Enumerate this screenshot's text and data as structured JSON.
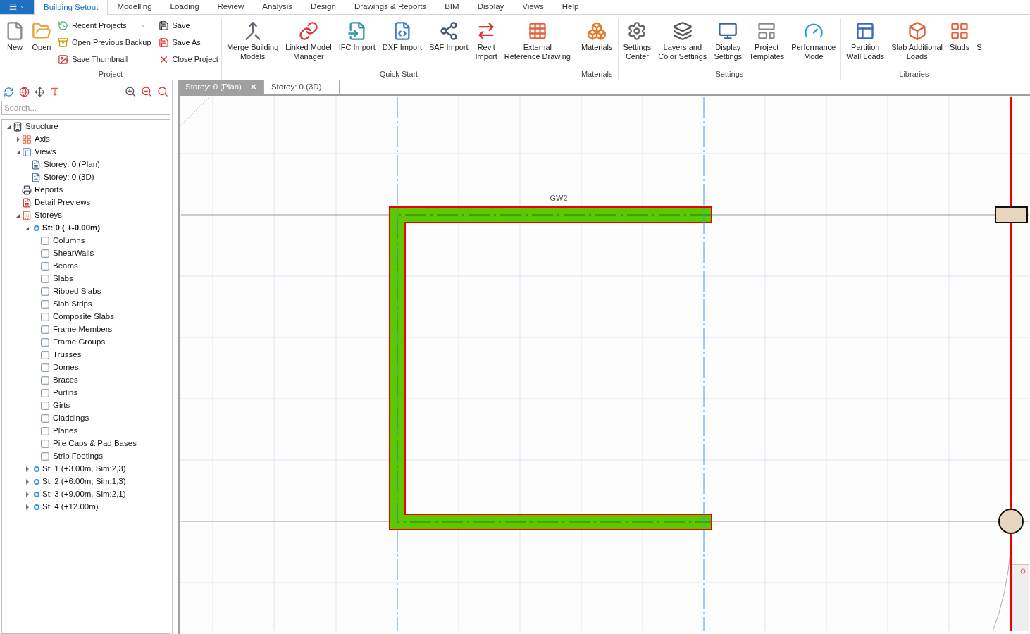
{
  "ribbon_tabs": [
    {
      "label": "Building Setout",
      "selected": true
    },
    {
      "label": "Modelling",
      "selected": false
    },
    {
      "label": "Loading",
      "selected": false
    },
    {
      "label": "Review",
      "selected": false
    },
    {
      "label": "Analysis",
      "selected": false
    },
    {
      "label": "Design",
      "selected": false
    },
    {
      "label": "Drawings & Reports",
      "selected": false
    },
    {
      "label": "BIM",
      "selected": false
    },
    {
      "label": "Display",
      "selected": false
    },
    {
      "label": "Views",
      "selected": false
    },
    {
      "label": "Help",
      "selected": false
    }
  ],
  "ribbon_groups": [
    {
      "title": "Project",
      "items": [
        {
          "kind": "large",
          "label": "New"
        },
        {
          "kind": "large",
          "label": "Open"
        },
        {
          "kind": "small",
          "label": "Recent Projects",
          "dropdown": true
        },
        {
          "kind": "small",
          "label": "Open Previous Backup",
          "dropdown": false
        },
        {
          "kind": "small",
          "label": "Save Thumbnail",
          "dropdown": false
        },
        {
          "kind": "small",
          "label": "Save",
          "dropdown": false
        },
        {
          "kind": "small",
          "label": "Save As",
          "dropdown": false
        },
        {
          "kind": "small",
          "label": "Close Project",
          "dropdown": false
        }
      ]
    },
    {
      "title": "Quick Start",
      "items": [
        {
          "kind": "large",
          "label": "Merge Building\nModels"
        },
        {
          "kind": "large",
          "label": "Linked Model\nManager"
        },
        {
          "kind": "large",
          "label": "IFC Import"
        },
        {
          "kind": "large",
          "label": "DXF Import"
        },
        {
          "kind": "large",
          "label": "SAF Import"
        },
        {
          "kind": "large",
          "label": "Revit\nImport"
        },
        {
          "kind": "large",
          "label": "External\nReference Drawing"
        }
      ]
    },
    {
      "title": "Materials",
      "items": [
        {
          "kind": "large",
          "label": "Materials"
        }
      ]
    },
    {
      "title": "Settings",
      "items": [
        {
          "kind": "large",
          "label": "Settings\nCenter"
        },
        {
          "kind": "large",
          "label": "Layers and\nColor Settings"
        },
        {
          "kind": "large",
          "label": "Display\nSettings"
        },
        {
          "kind": "large",
          "label": "Project\nTemplates"
        },
        {
          "kind": "large",
          "label": "Performance\nMode"
        }
      ]
    },
    {
      "title": "Libraries",
      "items": [
        {
          "kind": "large",
          "label": "Partition\nWall Loads"
        },
        {
          "kind": "large",
          "label": "Slab Additional\nLoads"
        },
        {
          "kind": "large",
          "label": "Studs"
        },
        {
          "kind": "large",
          "label": "S"
        }
      ]
    }
  ],
  "sidebar": {
    "search": {
      "placeholder": "Search..."
    },
    "tree": [
      {
        "label": "Structure",
        "kind": "structure",
        "expanded": true,
        "children": [
          {
            "label": "Axis",
            "kind": "axis",
            "expanded": false
          },
          {
            "label": "Views",
            "kind": "views",
            "expanded": true,
            "children": [
              {
                "label": "Storey: 0 (Plan)",
                "kind": "plan-view"
              },
              {
                "label": "Storey: 0 (3D)",
                "kind": "view-3d"
              }
            ]
          },
          {
            "label": "Reports",
            "kind": "reports"
          },
          {
            "label": "Detail Previews",
            "kind": "previews"
          },
          {
            "label": "Storeys",
            "kind": "storeys",
            "expanded": true,
            "children": [
              {
                "label": "St: 0 ( +-0.00m)",
                "kind": "storey",
                "active": true,
                "expanded": true,
                "children": [
                  {
                    "label": "Columns",
                    "kind": "category"
                  },
                  {
                    "label": "ShearWalls",
                    "kind": "category"
                  },
                  {
                    "label": "Beams",
                    "kind": "category"
                  },
                  {
                    "label": "Slabs",
                    "kind": "category"
                  },
                  {
                    "label": "Ribbed Slabs",
                    "kind": "category"
                  },
                  {
                    "label": "Slab Strips",
                    "kind": "category"
                  },
                  {
                    "label": "Composite Slabs",
                    "kind": "category"
                  },
                  {
                    "label": "Frame Members",
                    "kind": "category"
                  },
                  {
                    "label": "Frame Groups",
                    "kind": "category"
                  },
                  {
                    "label": "Trusses",
                    "kind": "category"
                  },
                  {
                    "label": "Domes",
                    "kind": "category"
                  },
                  {
                    "label": "Braces",
                    "kind": "category"
                  },
                  {
                    "label": "Purlins",
                    "kind": "category"
                  },
                  {
                    "label": "Girts",
                    "kind": "category"
                  },
                  {
                    "label": "Claddings",
                    "kind": "category"
                  },
                  {
                    "label": "Planes",
                    "kind": "category"
                  },
                  {
                    "label": "Pile Caps & Pad Bases",
                    "kind": "category"
                  },
                  {
                    "label": "Strip Footings",
                    "kind": "category"
                  }
                ]
              },
              {
                "label": "St: 1 (+3.00m, Sim:2,3)",
                "kind": "storey",
                "active": false,
                "expanded": false
              },
              {
                "label": "St: 2 (+6.00m, Sim:1,3)",
                "kind": "storey",
                "active": false,
                "expanded": false
              },
              {
                "label": "St: 3 (+9.00m, Sim:2,1)",
                "kind": "storey",
                "active": false,
                "expanded": false
              },
              {
                "label": "St: 4 (+12.00m)",
                "kind": "storey",
                "active": false,
                "expanded": false
              }
            ]
          }
        ]
      }
    ]
  },
  "document_tabs": [
    {
      "label": "Storey: 0 (Plan)",
      "selected": true,
      "close": "✕"
    },
    {
      "label": "Storey: 0 (3D)",
      "selected": false
    }
  ],
  "canvas": {
    "wall_label": "GW2"
  }
}
